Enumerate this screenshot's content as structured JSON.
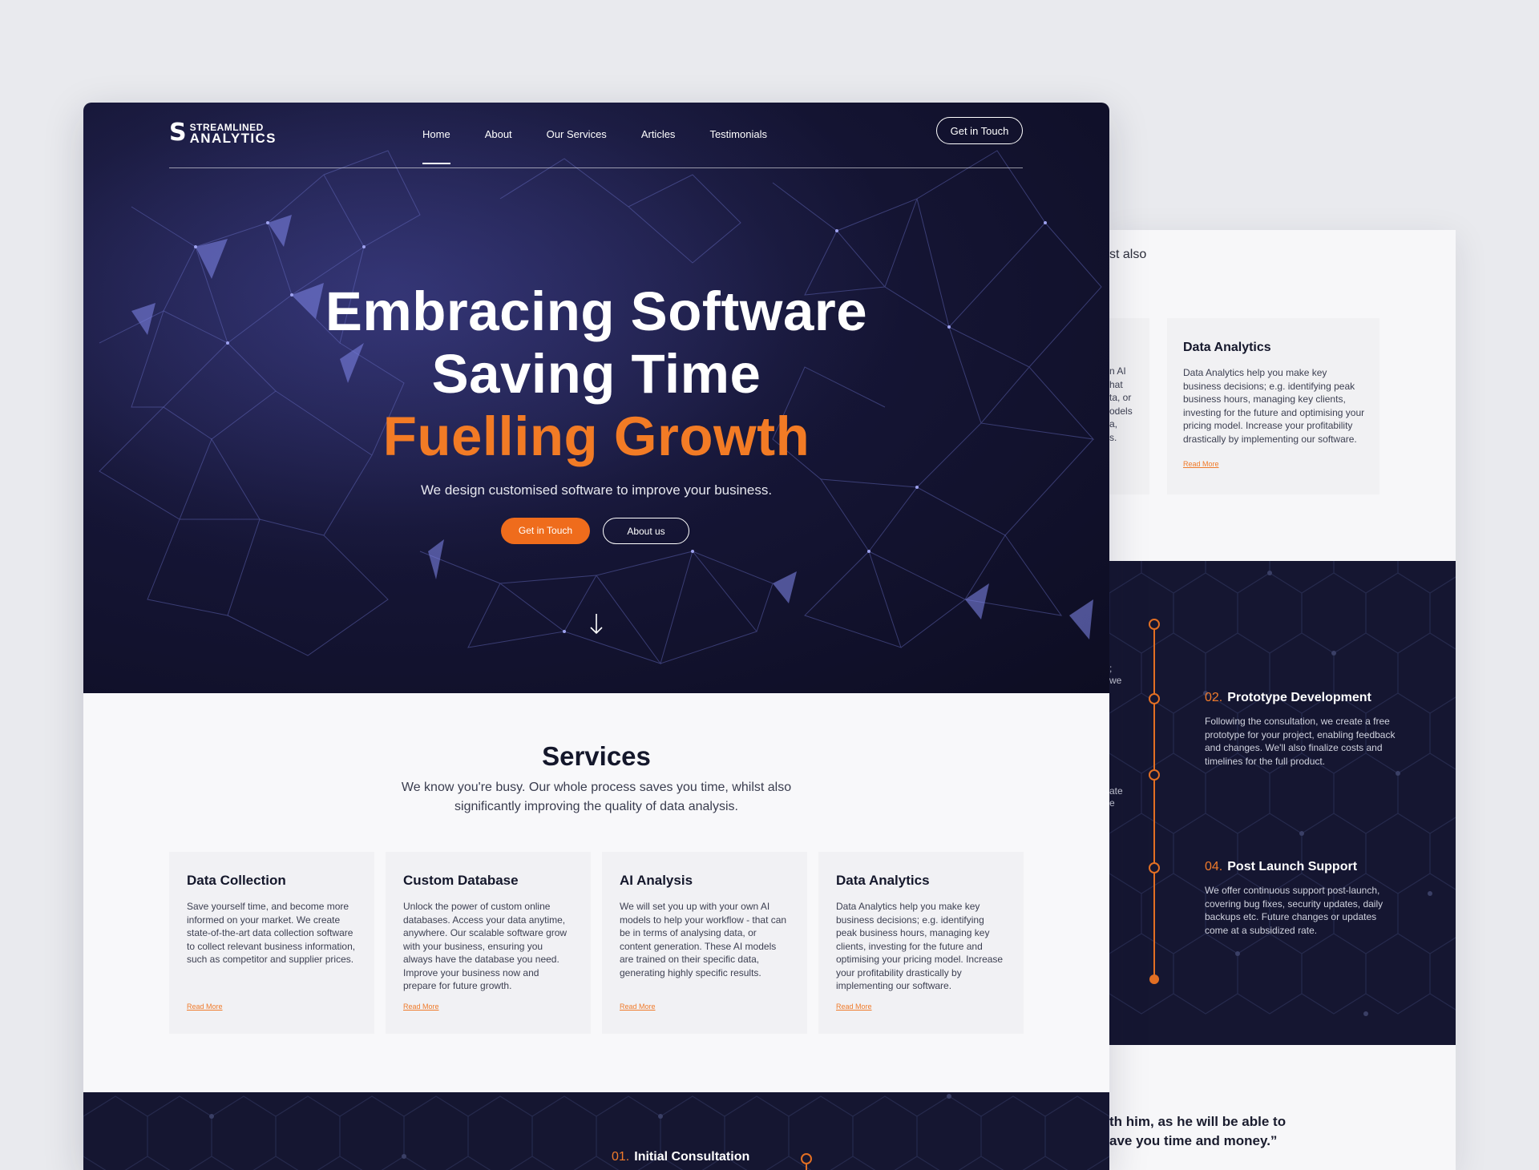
{
  "brand": {
    "line1": "STREAMLINED",
    "line2": "ANALYTICS"
  },
  "nav": {
    "links": [
      "Home",
      "About",
      "Our Services",
      "Articles",
      "Testimonials"
    ],
    "active": "Home",
    "cta": "Get in Touch"
  },
  "hero": {
    "title_line1": "Embracing Software",
    "title_line2": "Saving Time",
    "title_line3": "Fuelling Growth",
    "subtitle": "We design customised software to improve your business.",
    "btn_primary": "Get in Touch",
    "btn_secondary": "About us"
  },
  "services": {
    "title": "Services",
    "subtitle": "We know you're busy. Our whole process saves you time, whilst also significantly improving the quality of data analysis.",
    "cards": [
      {
        "title": "Data Collection",
        "text": "Save yourself time, and become more informed on your market. We create state-of-the-art data collection software to collect relevant business information, such as competitor and supplier prices.",
        "link": "Read More"
      },
      {
        "title": "Custom Database",
        "text": "Unlock the power of custom online databases. Access your data anytime, anywhere. Our scalable software grow with your business, ensuring you always have the database you need. Improve your business now and prepare for future growth.",
        "link": "Read More"
      },
      {
        "title": "AI Analysis",
        "text": "We will set you up with your own AI models to help your workflow - that can be in terms of analysing data, or content generation. These AI models are trained on their specific data, generating highly specific results.",
        "link": "Read More"
      },
      {
        "title": "Data Analytics",
        "text": "Data Analytics help you make key business decisions; e.g. identifying peak business hours, managing key clients, investing for the future and optimising your pricing model. Increase your profitability drastically by implementing our software.",
        "link": "Read More"
      }
    ]
  },
  "process": {
    "step1": {
      "num": "01.",
      "title": "Initial Consultation"
    }
  },
  "back_page": {
    "intro_tail": "st also",
    "card": {
      "title": "Data Analytics",
      "text": "Data Analytics help you make key business decisions; e.g. identifying peak business hours, managing key clients, investing for the future and optimising your pricing model. Increase your profitability drastically by implementing our software.",
      "link": "Read More"
    },
    "left_snips": [
      "n AI",
      "hat",
      "ta, or",
      "odels",
      "a,",
      "s."
    ],
    "dark_snips_a": [
      ";",
      "we"
    ],
    "dark_snips_b": [
      "ate",
      "e"
    ],
    "steps": [
      {
        "num": "02.",
        "title": "Prototype Development",
        "text": "Following the consultation, we create a free prototype for your project, enabling feedback and changes. We'll also finalize costs and timelines for the full product."
      },
      {
        "num": "04.",
        "title": "Post Launch Support",
        "text": "We offer continuous support post-launch, covering bug fixes, security updates, daily backups etc. Future changes or updates come at a subsidized rate."
      }
    ],
    "quote_line1": "th him, as he will be able to",
    "quote_line2": "ave you time and money.”"
  },
  "colors": {
    "accent": "#f27b25",
    "dark": "#151631",
    "light": "#f8f8fa"
  },
  "icons": {
    "scroll": "arrow-down-icon",
    "timeline_node": "circle-node-icon"
  }
}
